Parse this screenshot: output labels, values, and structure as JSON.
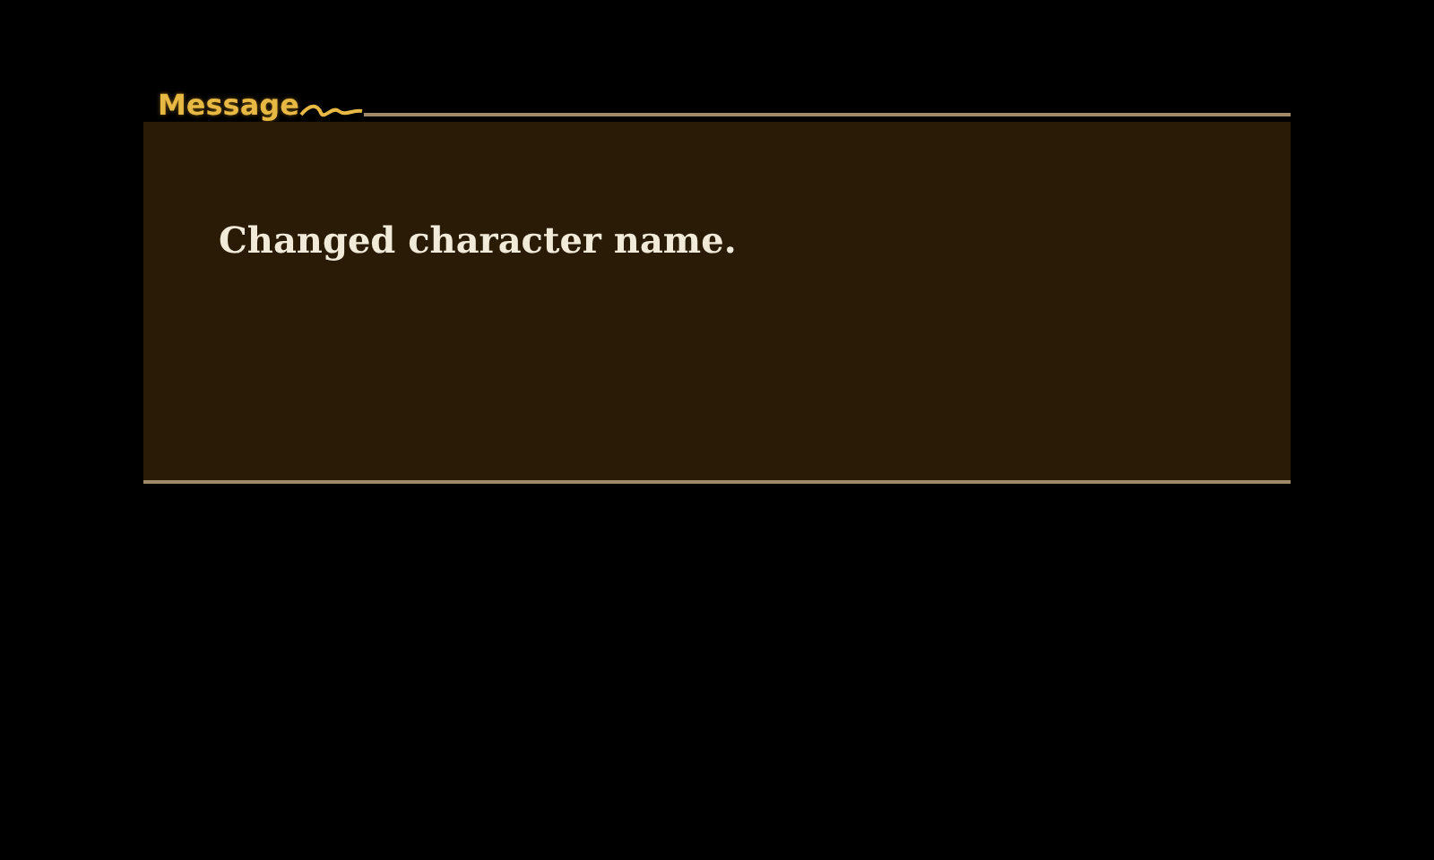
{
  "message_box": {
    "title": "Message",
    "text": "Changed character name."
  }
}
